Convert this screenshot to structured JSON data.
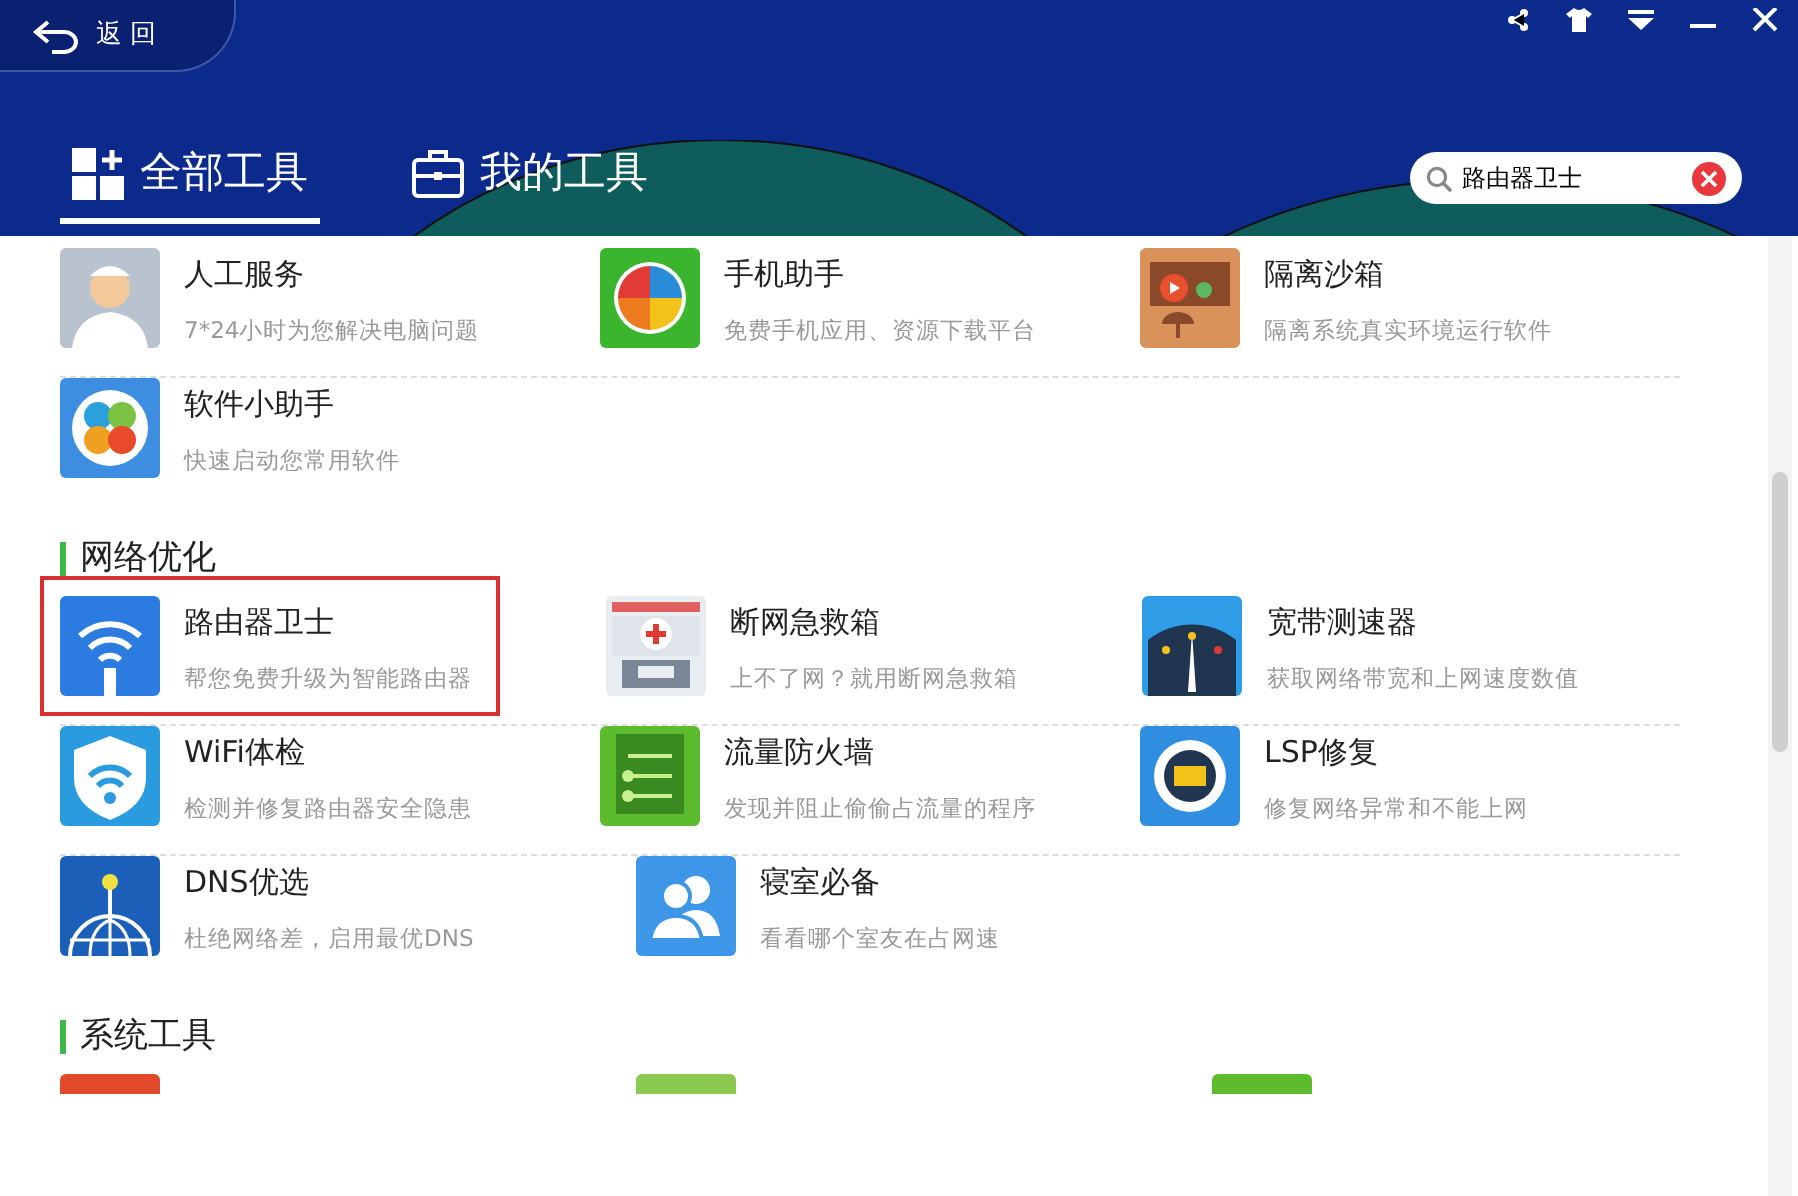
{
  "back_button": {
    "label": "返 回"
  },
  "tabs": [
    {
      "label": "全部工具",
      "selected": true
    },
    {
      "label": "我的工具",
      "selected": false
    }
  ],
  "search": {
    "value": "路由器卫士"
  },
  "sections": [
    {
      "rows": [
        [
          {
            "name": "人工服务",
            "desc": "7*24小时为您解决电脑问题",
            "highlighted": false
          },
          {
            "name": "手机助手",
            "desc": "免费手机应用、资源下载平台",
            "highlighted": false
          },
          {
            "name": "隔离沙箱",
            "desc": "隔离系统真实环境运行软件",
            "highlighted": false
          }
        ],
        [
          {
            "name": "软件小助手",
            "desc": "快速启动您常用软件",
            "highlighted": false
          }
        ]
      ]
    },
    {
      "title": "网络优化",
      "rows": [
        [
          {
            "name": "路由器卫士",
            "desc": "帮您免费升级为智能路由器",
            "highlighted": true
          },
          {
            "name": "断网急救箱",
            "desc": "上不了网？就用断网急救箱",
            "highlighted": false
          },
          {
            "name": "宽带测速器",
            "desc": "获取网络带宽和上网速度数值",
            "highlighted": false
          }
        ],
        [
          {
            "name": "WiFi体检",
            "desc": "检测并修复路由器安全隐患",
            "highlighted": false
          },
          {
            "name": "流量防火墙",
            "desc": "发现并阻止偷偷占流量的程序",
            "highlighted": false
          },
          {
            "name": "LSP修复",
            "desc": "修复网络异常和不能上网",
            "highlighted": false
          }
        ],
        [
          {
            "name": "DNS优选",
            "desc": "杜绝网络差，启用最优DNS",
            "highlighted": false
          },
          {
            "name": "寝室必备",
            "desc": "看看哪个室友在占网速",
            "highlighted": false
          }
        ]
      ]
    },
    {
      "title": "系统工具"
    }
  ]
}
